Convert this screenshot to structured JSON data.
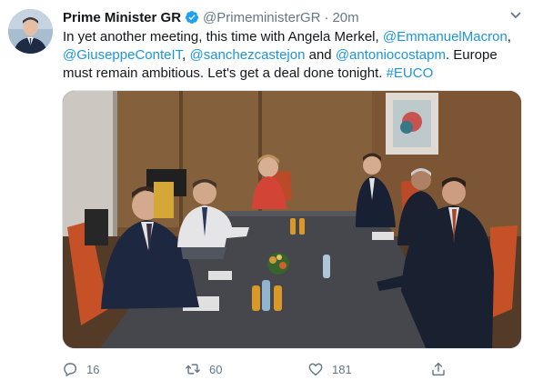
{
  "tweet": {
    "author_name": "Prime Minister GR",
    "handle": "@PrimeministerGR",
    "separator": "·",
    "time": "20m",
    "text": {
      "p1": "In yet another meeting, this time with Angela Merkel, ",
      "m1": "@EmmanuelMacron",
      "p2": ", ",
      "m2": "@GiuseppeConteIT",
      "p3": ", ",
      "m3": "@sanchezcastejon",
      "p4": " and ",
      "m4": "@antoniocostapm",
      "p5": ". Europe must remain ambitious. Let's get a deal done tonight. ",
      "h1": "#EUCO"
    },
    "actions": {
      "replies": "16",
      "retweets": "60",
      "likes": "181"
    }
  },
  "colors": {
    "link": "#1b95e0",
    "secondary": "#657786",
    "verified": "#1da1f2"
  },
  "icons": [
    "verified-badge-icon",
    "chevron-down-icon",
    "reply-icon",
    "retweet-icon",
    "like-icon",
    "share-icon"
  ]
}
